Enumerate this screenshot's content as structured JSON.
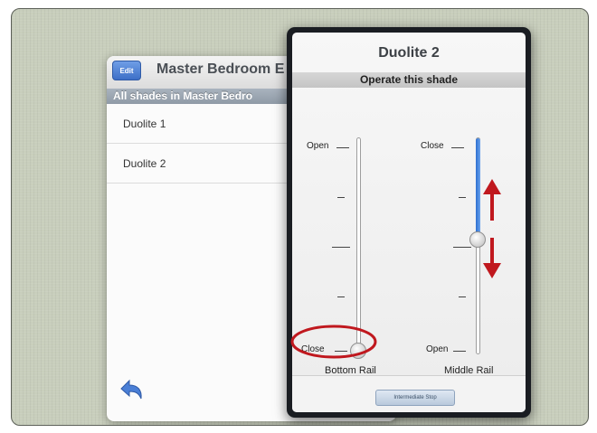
{
  "list_panel": {
    "edit_label": "Edit",
    "title": "Master Bedroom E",
    "subheader": "All shades in Master Bedro",
    "items": [
      {
        "label": "Duolite 1"
      },
      {
        "label": "Duolite 2"
      }
    ],
    "back_icon": "back-arrow-icon"
  },
  "popup": {
    "title": "Duolite 2",
    "subtitle": "Operate this shade",
    "bottom_rail": {
      "label": "Bottom Rail",
      "top_label": "Open",
      "bottom_label": "Close",
      "position": 1.0
    },
    "middle_rail": {
      "label": "Middle Rail",
      "top_label": "Close",
      "bottom_label": "Open",
      "position": 0.5
    },
    "stop_button": "Intermediate Stop"
  },
  "colors": {
    "accent_blue": "#3d6fc7",
    "annotation_red": "#c0181e",
    "desktop": "#c8cebc"
  }
}
